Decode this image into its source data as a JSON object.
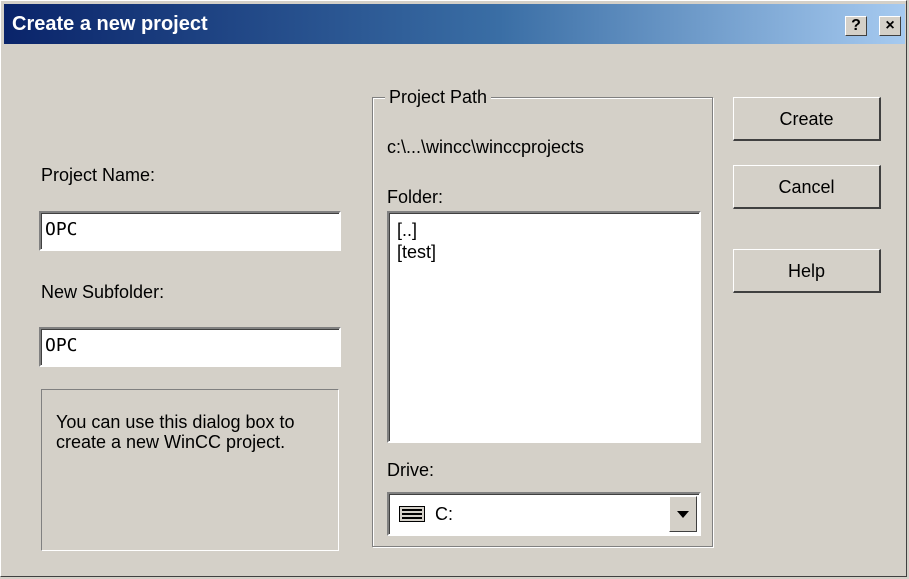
{
  "window": {
    "title": "Create a new project",
    "help_button": "?",
    "close_button": "×"
  },
  "left": {
    "project_name_label": "Project Name:",
    "project_name_value": "OPC",
    "subfolder_label": "New Subfolder:",
    "subfolder_value": "OPC",
    "info_text": "You can use this dialog box to create a new WinCC project."
  },
  "path_group": {
    "legend": "Project Path",
    "path": "c:\\...\\wincc\\winccprojects",
    "folder_label": "Folder:",
    "folders": [
      "[..]",
      "[test]"
    ],
    "drive_label": "Drive:",
    "drive_value": "C:",
    "drive_icon": "drive-icon",
    "dropdown_icon": "chevron-down-icon"
  },
  "buttons": {
    "create": "Create",
    "cancel": "Cancel",
    "help": "Help"
  },
  "colors": {
    "titlebar_start": "#0a246a",
    "titlebar_end": "#a6caf0",
    "face": "#d4d0c8"
  }
}
